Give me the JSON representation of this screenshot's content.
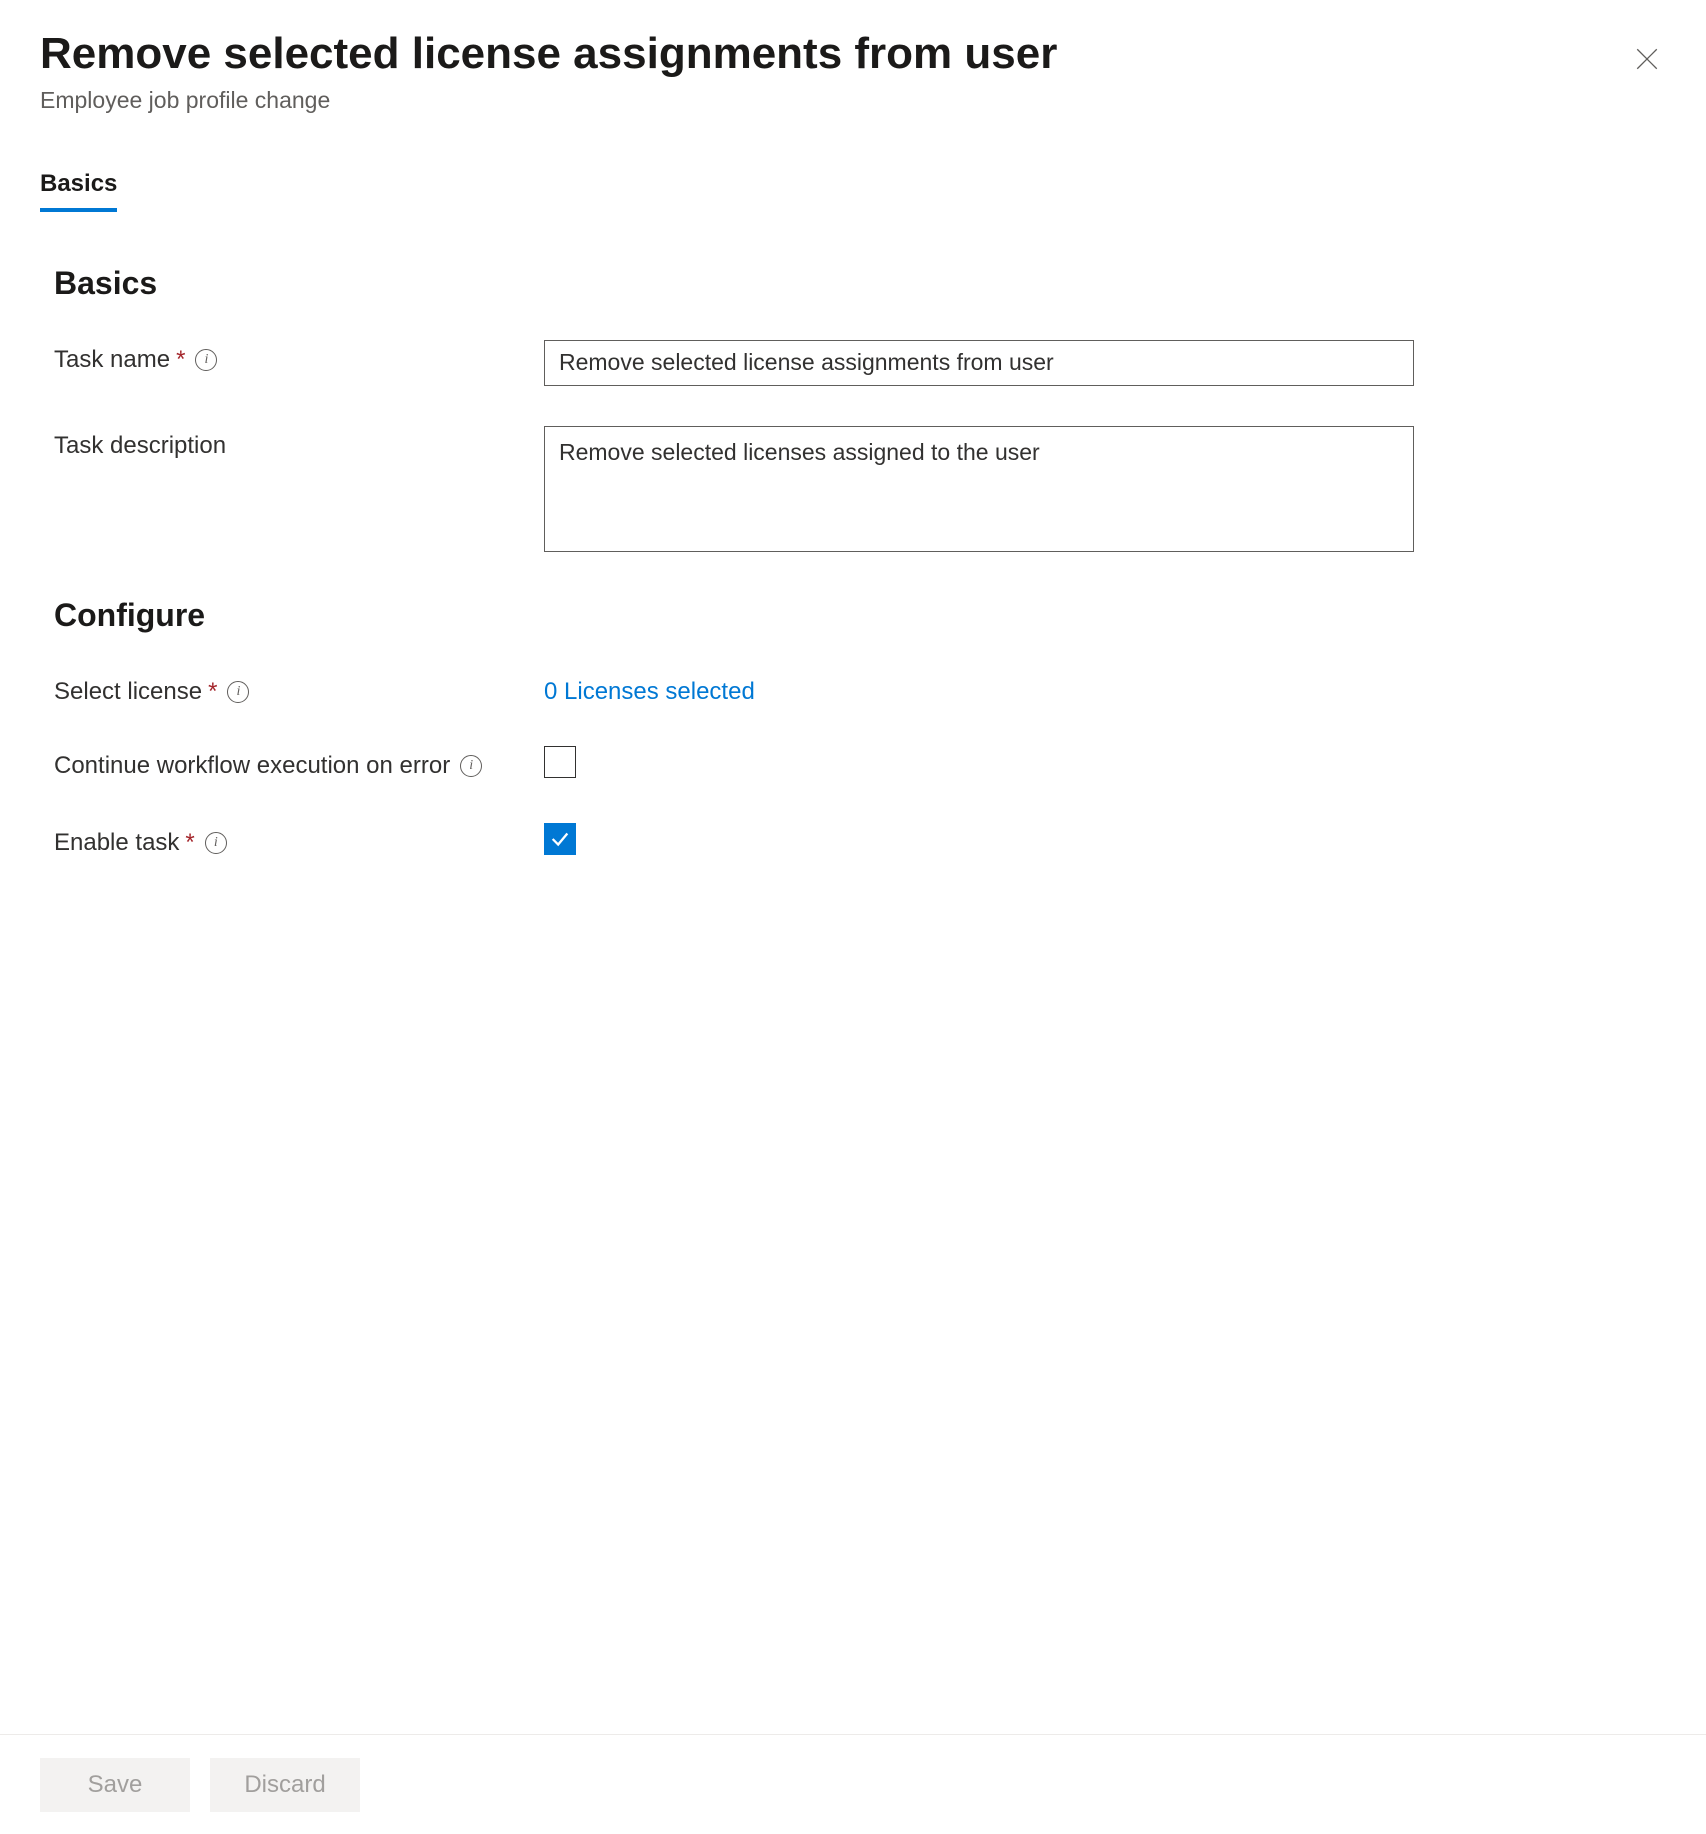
{
  "header": {
    "title": "Remove selected license assignments from user",
    "subtitle": "Employee job profile change"
  },
  "tabs": {
    "basics": "Basics"
  },
  "sections": {
    "basics_title": "Basics",
    "configure_title": "Configure"
  },
  "form": {
    "task_name": {
      "label": "Task name",
      "value": "Remove selected license assignments from user"
    },
    "task_description": {
      "label": "Task description",
      "value": "Remove selected licenses assigned to the user"
    },
    "select_license": {
      "label": "Select license",
      "value": "0 Licenses selected"
    },
    "continue_on_error": {
      "label": "Continue workflow execution on error",
      "checked": false
    },
    "enable_task": {
      "label": "Enable task",
      "checked": true
    }
  },
  "footer": {
    "save": "Save",
    "discard": "Discard"
  }
}
